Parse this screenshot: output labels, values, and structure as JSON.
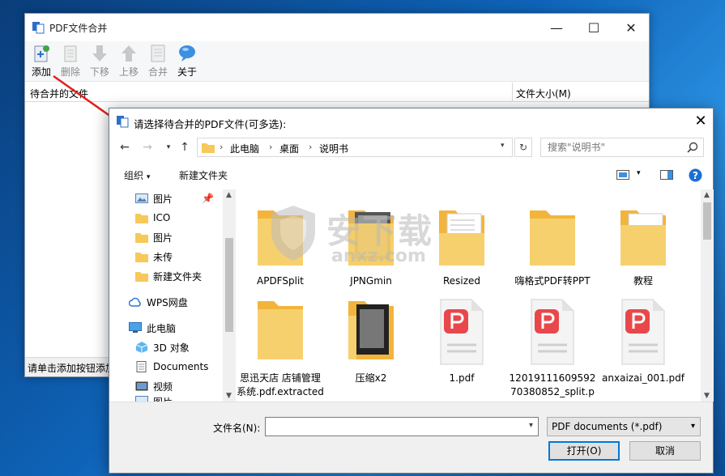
{
  "main_window": {
    "title": "PDF文件合并",
    "toolbar": [
      {
        "label": "添加",
        "icon": "add-file-icon",
        "enabled": true
      },
      {
        "label": "删除",
        "icon": "delete-file-icon",
        "enabled": false
      },
      {
        "label": "下移",
        "icon": "move-down-icon",
        "enabled": false
      },
      {
        "label": "上移",
        "icon": "move-up-icon",
        "enabled": false
      },
      {
        "label": "合并",
        "icon": "merge-icon",
        "enabled": false
      },
      {
        "label": "关于",
        "icon": "about-icon",
        "enabled": true
      }
    ],
    "columns": [
      "待合并的文件",
      "文件大小(M)"
    ],
    "status": "请单击添加按钮添加"
  },
  "dialog": {
    "title": "请选择待合并的PDF文件(可多选):",
    "breadcrumb": [
      "此电脑",
      "桌面",
      "说明书"
    ],
    "search_placeholder": "搜索\"说明书\"",
    "commands": {
      "organize": "组织",
      "new_folder": "新建文件夹"
    },
    "nav_items": [
      {
        "label": "图片",
        "icon": "pictures-icon",
        "pinned": true
      },
      {
        "label": "ICO",
        "icon": "folder-icon"
      },
      {
        "label": "图片",
        "icon": "folder-icon"
      },
      {
        "label": "未传",
        "icon": "folder-icon"
      },
      {
        "label": "新建文件夹",
        "icon": "folder-icon"
      },
      {
        "label": "WPS网盘",
        "icon": "cloud-icon"
      },
      {
        "label": "此电脑",
        "icon": "computer-icon"
      },
      {
        "label": "3D 对象",
        "icon": "3d-objects-icon"
      },
      {
        "label": "Documents",
        "icon": "documents-icon"
      },
      {
        "label": "视频",
        "icon": "videos-icon"
      },
      {
        "label": "图片",
        "icon": "pictures-icon"
      }
    ],
    "files": [
      {
        "name": "APDFSplit",
        "kind": "folder"
      },
      {
        "name": "JPNGmin",
        "kind": "folder-photo"
      },
      {
        "name": "Resized",
        "kind": "folder-doc"
      },
      {
        "name": "嗨格式PDF转PPT",
        "kind": "folder"
      },
      {
        "name": "教程",
        "kind": "folder-doc"
      },
      {
        "name": "思迅天店 店铺管理系统.pdf.extracted_i",
        "kind": "folder"
      },
      {
        "name": "压缩x2",
        "kind": "folder-photo"
      },
      {
        "name": "1.pdf",
        "kind": "pdf"
      },
      {
        "name": "1201911160959270380852_split.pdf",
        "kind": "pdf"
      },
      {
        "name": "anxaizai_001.pdf",
        "kind": "pdf"
      }
    ],
    "filename_label": "文件名(N):",
    "filename_value": "",
    "filetype": "PDF documents (*.pdf)",
    "open_label": "打开(O)",
    "cancel_label": "取消"
  },
  "watermark": {
    "line1": "安下载",
    "line2": "anxz.com"
  },
  "colors": {
    "accent": "#0078d7",
    "folder": "#f7c95a",
    "pdf_red": "#e8484b",
    "annotation_arrow": "#e0201b"
  }
}
